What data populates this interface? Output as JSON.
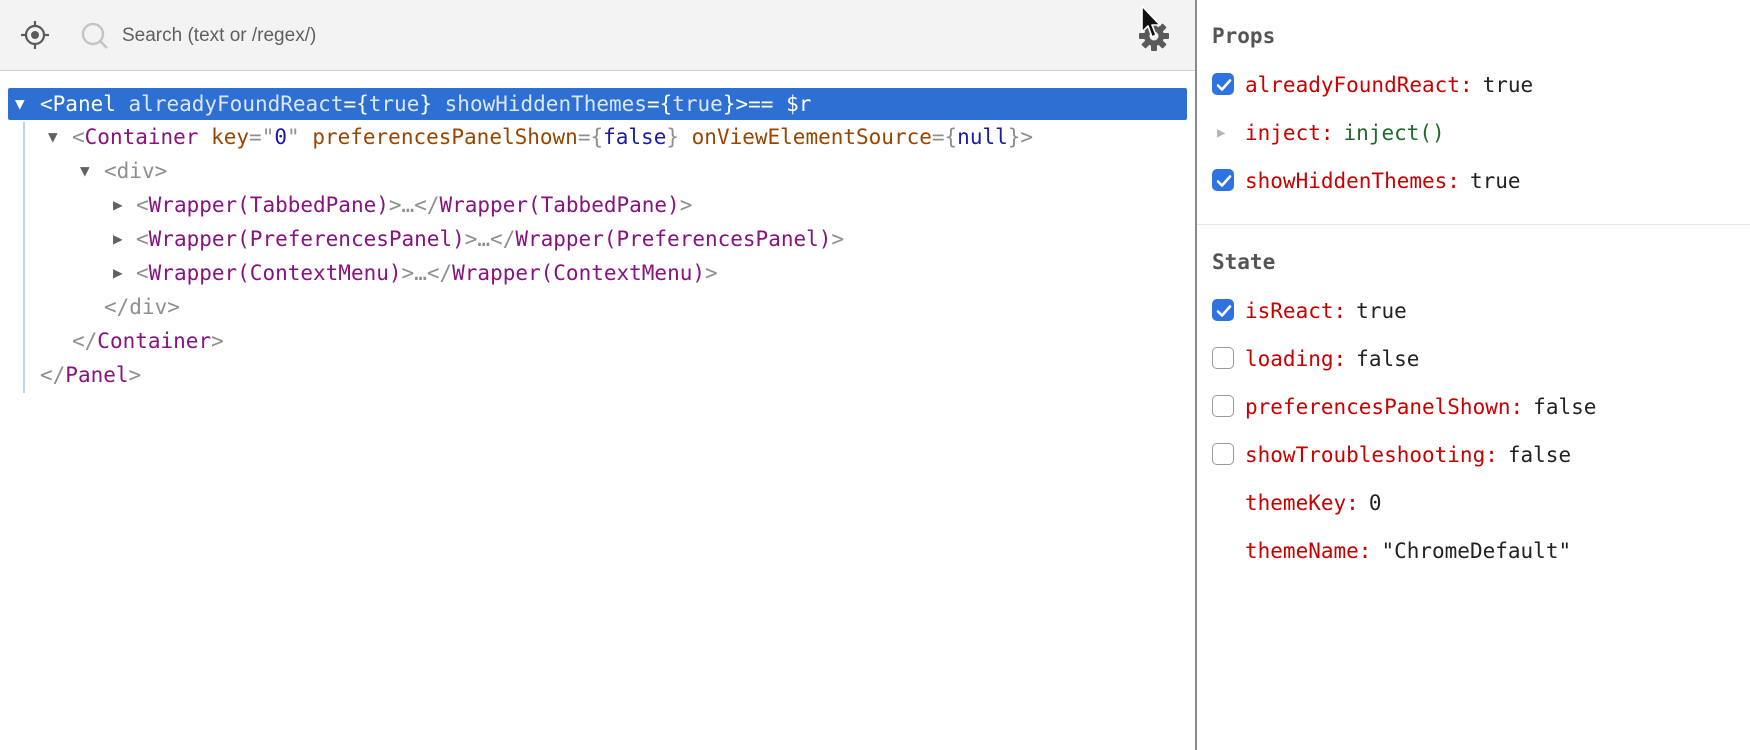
{
  "toolbar": {
    "search_placeholder": "Search (text or /regex/)",
    "icons": [
      "locate-icon",
      "search-icon",
      "settings-icon",
      "mouse-cursor-icon"
    ]
  },
  "tree": {
    "rows": [
      {
        "open": "<",
        "name": "Panel",
        "attrs": [
          {
            "name": "alreadyFoundReact",
            "eq": "={",
            "value": "true",
            "end": "}"
          },
          {
            "name": "showHiddenThemes",
            "eq": "={",
            "value": "true",
            "end": "}"
          }
        ],
        "close": ">",
        "suffix": "== $r",
        "arrow": "▼"
      },
      {
        "open": "<",
        "name": "Container",
        "attrs": [
          {
            "name": "key",
            "eq": "=\"",
            "value": "0",
            "end": "\""
          },
          {
            "name": "preferencesPanelShown",
            "eq": "={",
            "value": "false",
            "end": "}"
          },
          {
            "name": "onViewElementSource",
            "eq": "={",
            "value": "null",
            "end": "}"
          }
        ],
        "close": ">",
        "arrow": "▼"
      },
      {
        "open": "<",
        "name": "div",
        "close": ">",
        "arrow": "▼"
      },
      {
        "open": "<",
        "name": "Wrapper(TabbedPane)",
        "close": ">",
        "ellipsis": "…",
        "endtag": "</",
        "endname": "Wrapper(TabbedPane)",
        "endclose": ">",
        "arrow": "▶"
      },
      {
        "open": "<",
        "name": "Wrapper(PreferencesPanel)",
        "close": ">",
        "ellipsis": "…",
        "endtag": "</",
        "endname": "Wrapper(PreferencesPanel)",
        "endclose": ">",
        "arrow": "▶"
      },
      {
        "open": "<",
        "name": "Wrapper(ContextMenu)",
        "close": ">",
        "ellipsis": "…",
        "endtag": "</",
        "endname": "Wrapper(ContextMenu)",
        "endclose": ">",
        "arrow": "▶"
      },
      {
        "open": "</",
        "name": "div",
        "close": ">"
      },
      {
        "open": "</",
        "name": "Container",
        "close": ">"
      },
      {
        "open": "</",
        "name": "Panel",
        "close": ">"
      }
    ]
  },
  "sidebar": {
    "props_title": "Props",
    "props": [
      {
        "name": "alreadyFoundReact",
        "colon": ":",
        "value": "true",
        "checkbox": true,
        "checked": true
      },
      {
        "name": "inject",
        "colon": ":",
        "value": "inject()",
        "expandable": true,
        "expander": "▶"
      },
      {
        "name": "showHiddenThemes",
        "colon": ":",
        "value": "true",
        "checkbox": true,
        "checked": true
      }
    ],
    "state_title": "State",
    "state": [
      {
        "name": "isReact",
        "colon": ":",
        "value": "true",
        "checkbox": true,
        "checked": true
      },
      {
        "name": "loading",
        "colon": ":",
        "value": "false",
        "checkbox": true,
        "checked": false
      },
      {
        "name": "preferencesPanelShown",
        "colon": ":",
        "value": "false",
        "checkbox": true,
        "checked": false
      },
      {
        "name": "showTroubleshooting",
        "colon": ":",
        "value": "false",
        "checkbox": true,
        "checked": false
      },
      {
        "name": "themeKey",
        "colon": ":",
        "value": "0"
      },
      {
        "name": "themeName",
        "colon": ":",
        "value": "\"ChromeDefault\""
      }
    ]
  },
  "colors": {
    "selection": "#2e6fd3",
    "tag": "#881280",
    "attr_name": "#994500",
    "attr_value": "#1a1aa6",
    "prop_name": "#c80000",
    "checkbox": "#2f73e0"
  }
}
